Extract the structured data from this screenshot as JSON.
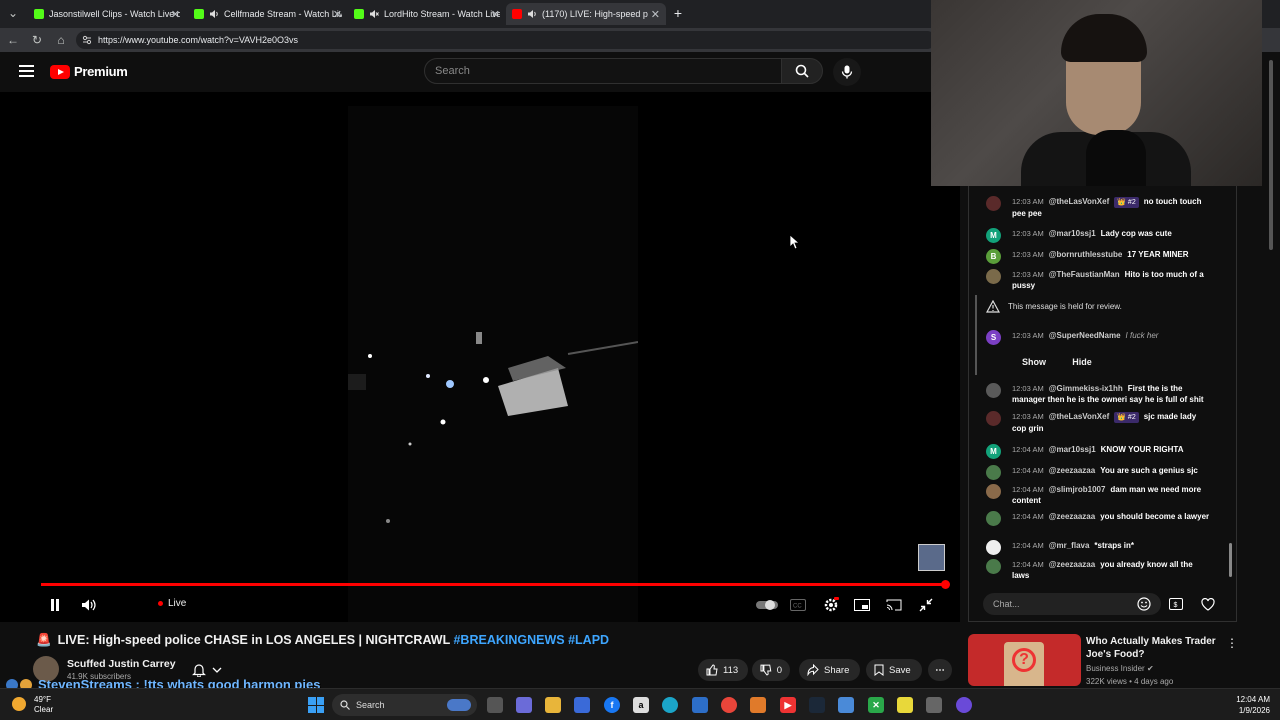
{
  "browser": {
    "tabs": [
      {
        "title": "Jasonstilwell Clips - Watch Live on",
        "favicon_color": "#53fc18"
      },
      {
        "title": "Cellfmade Stream - Watch Live",
        "favicon_color": "#53fc18"
      },
      {
        "title": "LordHito Stream - Watch Live",
        "favicon_color": "#53fc18"
      },
      {
        "title": "(1170) LIVE: High-speed p",
        "favicon_color": "#ff0000"
      }
    ],
    "new_tab_label": "+",
    "url": "https://www.youtube.com/watch?v=VAVH2e0O3vs"
  },
  "youtube": {
    "logo_text": "Premium",
    "search_placeholder": "Search"
  },
  "player": {
    "live_label": "Live",
    "progress_fraction": 1.0
  },
  "video": {
    "title_main": "LIVE: High-speed police CHASE in LOS ANGELES | NIGHTCRAWL",
    "title_tags": "#BREAKINGNEWS #LAPD",
    "channel_name": "Scuffed Justin Carrey",
    "subscribers": "41.9K subscribers",
    "likes": "113",
    "dislikes": "0",
    "share_label": "Share",
    "save_label": "Save"
  },
  "chat": {
    "messages": [
      {
        "time": "12:03 AM",
        "user": "@theLasVonXef",
        "badge": "👑 #2",
        "text": "no touch touch pee pee",
        "avatar": "",
        "avatar_color": "#5a2a2a"
      },
      {
        "time": "12:03 AM",
        "user": "@mar10ssj1",
        "text": "Lady cop was cute",
        "avatar": "M",
        "avatar_color": "#12a27a"
      },
      {
        "time": "12:03 AM",
        "user": "@bornruthlesstube",
        "text": "17 YEAR MINER",
        "avatar": "B",
        "avatar_color": "#5a9e3a"
      },
      {
        "time": "12:03 AM",
        "user": "@TheFaustianMan",
        "text": "Hito is too much of a pussy",
        "avatar": "",
        "avatar_color": "#7a6a4a"
      },
      {
        "time": "12:03 AM",
        "user": "@SuperNeedName",
        "text": "I fuck her",
        "avatar": "S",
        "avatar_color": "#7b3fc4",
        "held": true
      },
      {
        "time": "12:03 AM",
        "user": "@Gimmekiss-ix1hh",
        "text": "First the is the manager then he is the owneri say he is full of shit",
        "avatar": "",
        "avatar_color": "#5a5a5a"
      },
      {
        "time": "12:03 AM",
        "user": "@theLasVonXef",
        "badge": "👑 #2",
        "text": "sjc made lady cop grin",
        "avatar": "",
        "avatar_color": "#5a2a2a"
      },
      {
        "time": "12:04 AM",
        "user": "@mar10ssj1",
        "text": "KNOW YOUR RIGHTA",
        "avatar": "M",
        "avatar_color": "#12a27a"
      },
      {
        "time": "12:04 AM",
        "user": "@zeezaazaa",
        "text": "You are such a genius sjc",
        "avatar": "",
        "avatar_color": "#4a7a4a"
      },
      {
        "time": "12:04 AM",
        "user": "@slimjrob1007",
        "text": "dam man we need more content",
        "avatar": "",
        "avatar_color": "#8a6a4a"
      },
      {
        "time": "12:04 AM",
        "user": "@zeezaazaa",
        "text": "you should become a lawyer",
        "avatar": "",
        "avatar_color": "#4a7a4a"
      },
      {
        "time": "12:04 AM",
        "user": "@mr_flava",
        "text": "*straps in*",
        "avatar": "",
        "avatar_color": "#ddd"
      },
      {
        "time": "12:04 AM",
        "user": "@zeezaazaa",
        "text": "you already know all the laws",
        "avatar": "",
        "avatar_color": "#4a7a4a"
      }
    ],
    "held_notice": "This message is held for review.",
    "show_label": "Show",
    "hide_label": "Hide",
    "input_placeholder": "Chat..."
  },
  "recommendation": {
    "title": "Who Actually Makes Trader Joe's Food?",
    "channel": "Business Insider",
    "meta": "322K views • 4 days ago"
  },
  "overlay": {
    "alert_text": "StevenStreams : !tts whats good harmon pies"
  },
  "taskbar": {
    "temperature": "49°F",
    "condition": "Clear",
    "search_label": "Search",
    "time": "12:04 AM",
    "date": "1/9/2026"
  }
}
